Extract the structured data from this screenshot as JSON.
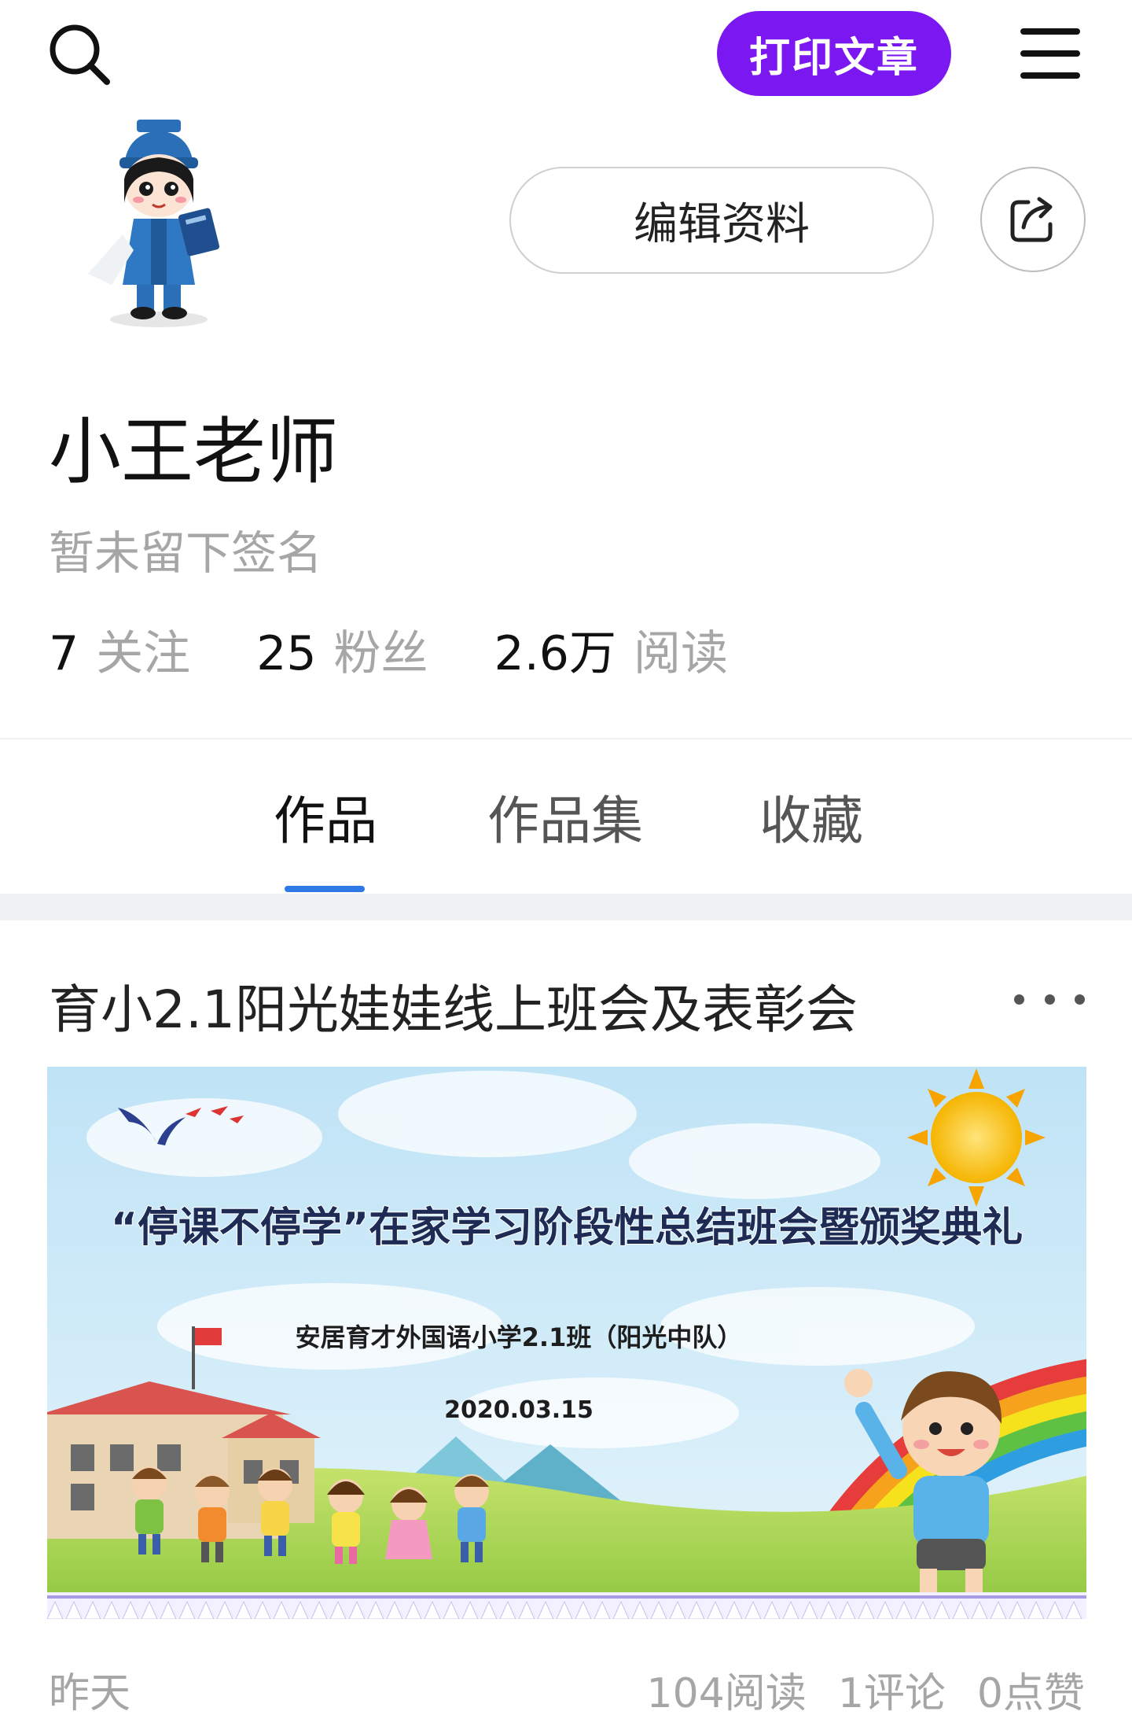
{
  "topbar": {
    "search_icon": "search-icon",
    "print_button_label": "打印文章",
    "menu_icon": "hamburger-menu-icon",
    "accent_color": "#7b17f0"
  },
  "profile": {
    "avatar_icon": "teacher-cartoon-avatar",
    "edit_button_label": "编辑资料",
    "share_icon": "share-icon",
    "username": "小王老师",
    "signature": "暂未留下签名",
    "stats": [
      {
        "value": "7",
        "label": "关注"
      },
      {
        "value": "25",
        "label": "粉丝"
      },
      {
        "value": "2.6万",
        "label": "阅读"
      }
    ]
  },
  "tabs": [
    {
      "label": "作品",
      "active": true
    },
    {
      "label": "作品集",
      "active": false
    },
    {
      "label": "收藏",
      "active": false
    }
  ],
  "tab_indicator_color": "#2d79e6",
  "article": {
    "title": "育小2.1阳光娃娃线上班会及表彰会",
    "more_icon": "more-dots-icon",
    "cover": {
      "headline": "“停课不停学”在家学习阶段性总结班会暨颁奖典礼",
      "subheading": "安居育才外国语小学2.1班（阳光中队）",
      "date": "2020.03.15"
    },
    "date": "昨天",
    "reads": "104阅读",
    "comments": "1评论",
    "likes": "0点赞"
  }
}
